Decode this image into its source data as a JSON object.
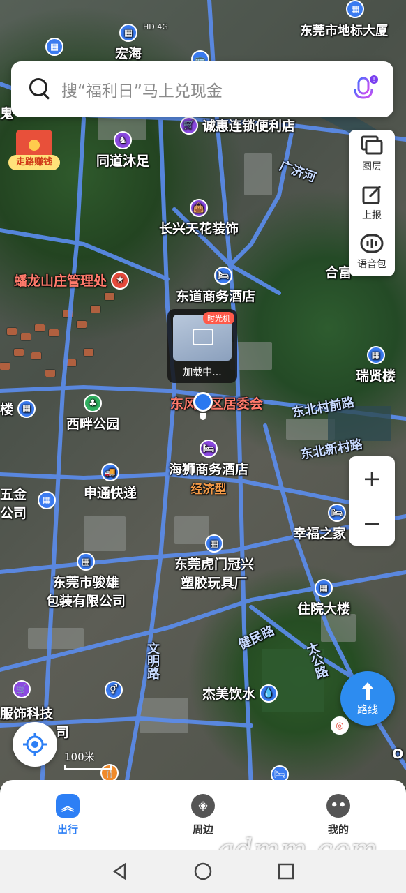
{
  "status_bar": {
    "signal": "HD 4G"
  },
  "search": {
    "placeholder": "搜“福利日”马上兑现金"
  },
  "promo": {
    "red_packet_tag": "走路赚钱"
  },
  "toolbar": {
    "layers": "图层",
    "report": "上报",
    "voice_pack": "语音包"
  },
  "time_machine": {
    "badge": "时光机",
    "loading": "加载中..."
  },
  "zoom": {
    "in": "+",
    "out": "−"
  },
  "route_button": {
    "label": "路线"
  },
  "scale": {
    "label": "100米"
  },
  "map_labels": {
    "hongHai": "宏海",
    "dongguanLandmark": "东莞市地标大厦",
    "guiPrefix": "鬼",
    "chenghui": "诚惠连锁便利店",
    "tongdao": "同道沐足",
    "guangjiRiver": "广济河",
    "changxing": "长兴天花装饰",
    "panlong": "蟠龙山庄管理处",
    "dongdao": "东道商务酒店",
    "hefu": "合富",
    "ruixian": "瑞贤楼",
    "dongfang": "东风社区居委会",
    "dongbeiVillage": "东北村前路",
    "xipan": "西畔公园",
    "dongbeiNew": "东北新村路",
    "louSuffix": "楼",
    "haishi": "海狮商务酒店",
    "jingjiQu": "经济型",
    "wujin": "五金",
    "gongsi1": "公司",
    "shentong": "申通快递",
    "xingfu": "幸福之家",
    "humen": "东莞虎门冠兴\n塑胶玩具厂",
    "junxiong": "东莞市骏雄\n包装有限公司",
    "zhuyuan": "住院大楼",
    "jianmin": "健民路",
    "wenming": "文明路",
    "taigong": "太公路",
    "jiemei": "杰美饮水",
    "fushi": "服饰科技",
    "gongsi2": "司",
    "oSuffix": "O"
  },
  "tabs": [
    {
      "label": "出行",
      "icon": "chevrons-up-icon",
      "active": true
    },
    {
      "label": "周边",
      "icon": "compass-icon",
      "active": false
    },
    {
      "label": "我的",
      "icon": "face-icon",
      "active": false
    }
  ],
  "watermark": "gdmm.com",
  "colors": {
    "accent": "#2d7ff5",
    "road": "#5b8def",
    "poi_red": "#ff7a6b"
  }
}
